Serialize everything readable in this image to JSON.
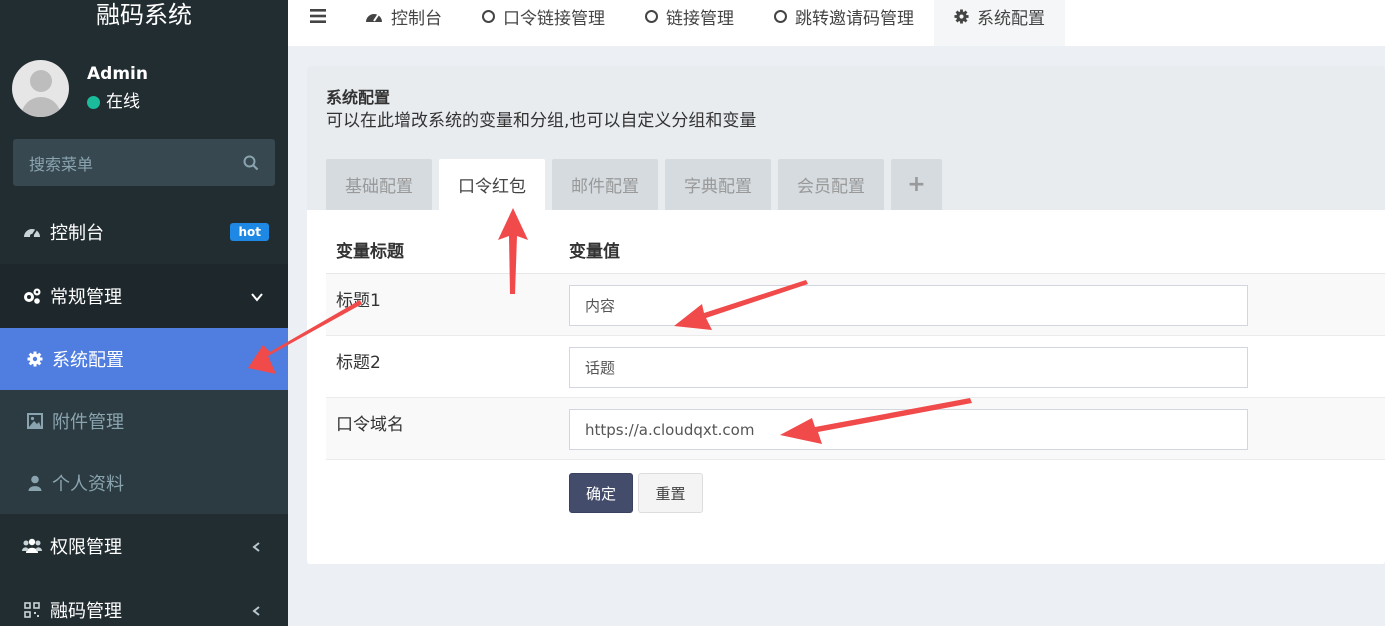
{
  "app": {
    "title": "融码系统"
  },
  "user": {
    "name": "Admin",
    "status": "在线"
  },
  "search": {
    "placeholder": "搜索菜单"
  },
  "sidebar": {
    "items": [
      {
        "label": "控制台",
        "badge": "hot"
      },
      {
        "label": "常规管理"
      },
      {
        "label": "权限管理"
      },
      {
        "label": "融码管理"
      }
    ],
    "sub_items": [
      {
        "label": "系统配置"
      },
      {
        "label": "附件管理"
      },
      {
        "label": "个人资料"
      }
    ]
  },
  "topnav": {
    "items": [
      {
        "label": "控制台"
      },
      {
        "label": "口令链接管理"
      },
      {
        "label": "链接管理"
      },
      {
        "label": "跳转邀请码管理"
      },
      {
        "label": "系统配置"
      }
    ]
  },
  "panel": {
    "title": "系统配置",
    "subtitle": "可以在此增改系统的变量和分组,也可以自定义分组和变量",
    "tabs": [
      "基础配置",
      "口令红包",
      "邮件配置",
      "字典配置",
      "会员配置",
      "+"
    ],
    "table": {
      "headers": [
        "变量标题",
        "变量值"
      ],
      "rows": [
        {
          "label": "标题1",
          "value": "内容"
        },
        {
          "label": "标题2",
          "value": "话题"
        },
        {
          "label": "口令域名",
          "value": "https://a.cloudqxt.com"
        }
      ]
    },
    "buttons": {
      "confirm": "确定",
      "reset": "重置"
    }
  },
  "colors": {
    "sidebar_bg": "#222d32",
    "active_item": "#4f7de0",
    "accent_arrow": "#f04a4a",
    "badge": "#1e88e5"
  }
}
